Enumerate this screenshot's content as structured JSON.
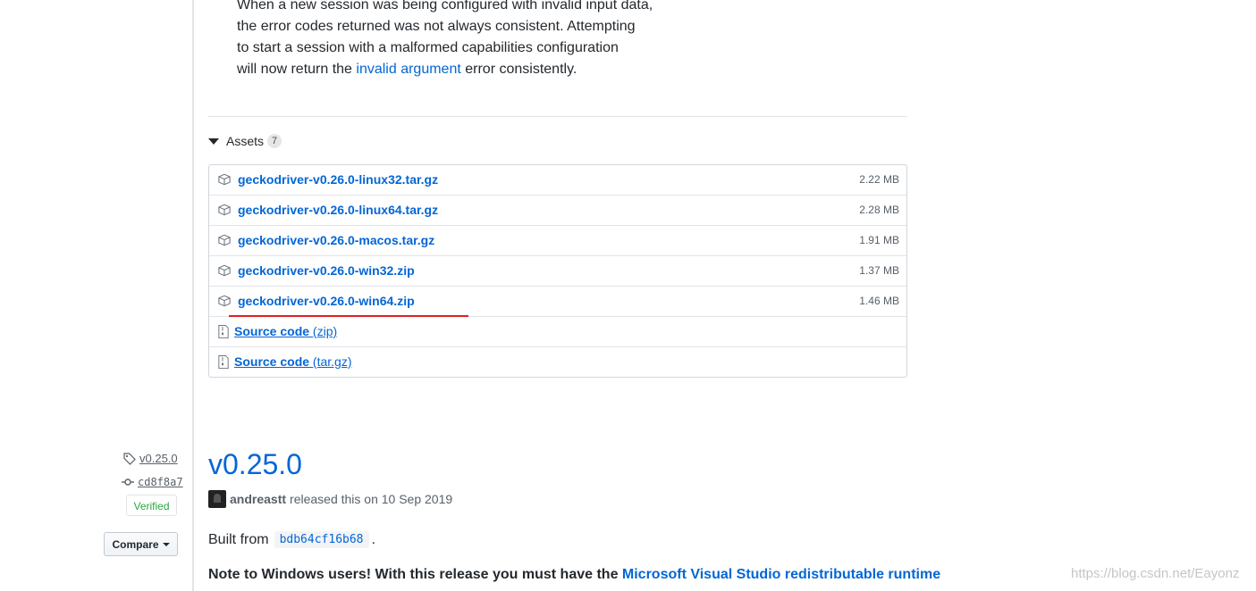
{
  "notes": {
    "line1": "When a new session was being configured with invalid input data,",
    "line2": "the error codes returned was not always consistent. Attempting",
    "line3": "to start a session with a malformed capabilities configuration",
    "line4_before": "will now return the ",
    "line4_link": "invalid argument",
    "line4_after": " error consistently."
  },
  "assets": {
    "label": "Assets",
    "count": "7",
    "files": [
      {
        "name": "geckodriver-v0.26.0-linux32.tar.gz",
        "size": "2.22 MB"
      },
      {
        "name": "geckodriver-v0.26.0-linux64.tar.gz",
        "size": "2.28 MB"
      },
      {
        "name": "geckodriver-v0.26.0-macos.tar.gz",
        "size": "1.91 MB"
      },
      {
        "name": "geckodriver-v0.26.0-win32.zip",
        "size": "1.37 MB"
      },
      {
        "name": "geckodriver-v0.26.0-win64.zip",
        "size": "1.46 MB"
      }
    ],
    "sources": [
      {
        "label": "Source code",
        "ext": "(zip)"
      },
      {
        "label": "Source code",
        "ext": "(tar.gz)"
      }
    ]
  },
  "sidebar": {
    "tag": "v0.25.0",
    "commit": "cd8f8a7",
    "verified": "Verified",
    "compare": "Compare"
  },
  "release": {
    "title": "v0.25.0",
    "author": "andreastt",
    "released_text": "released this on 10 Sep 2019",
    "built_from_label": "Built from",
    "built_from_ref": "bdb64cf16b68",
    "built_from_end": ".",
    "note_text": "Note to Windows users! With this release you must have the ",
    "note_link": "Microsoft Visual Studio redistributable runtime"
  },
  "watermark": "https://blog.csdn.net/Eayonz",
  "colors": {
    "link": "#0366d6",
    "verified": "#28a745",
    "highlight_underline": "#e02020"
  }
}
